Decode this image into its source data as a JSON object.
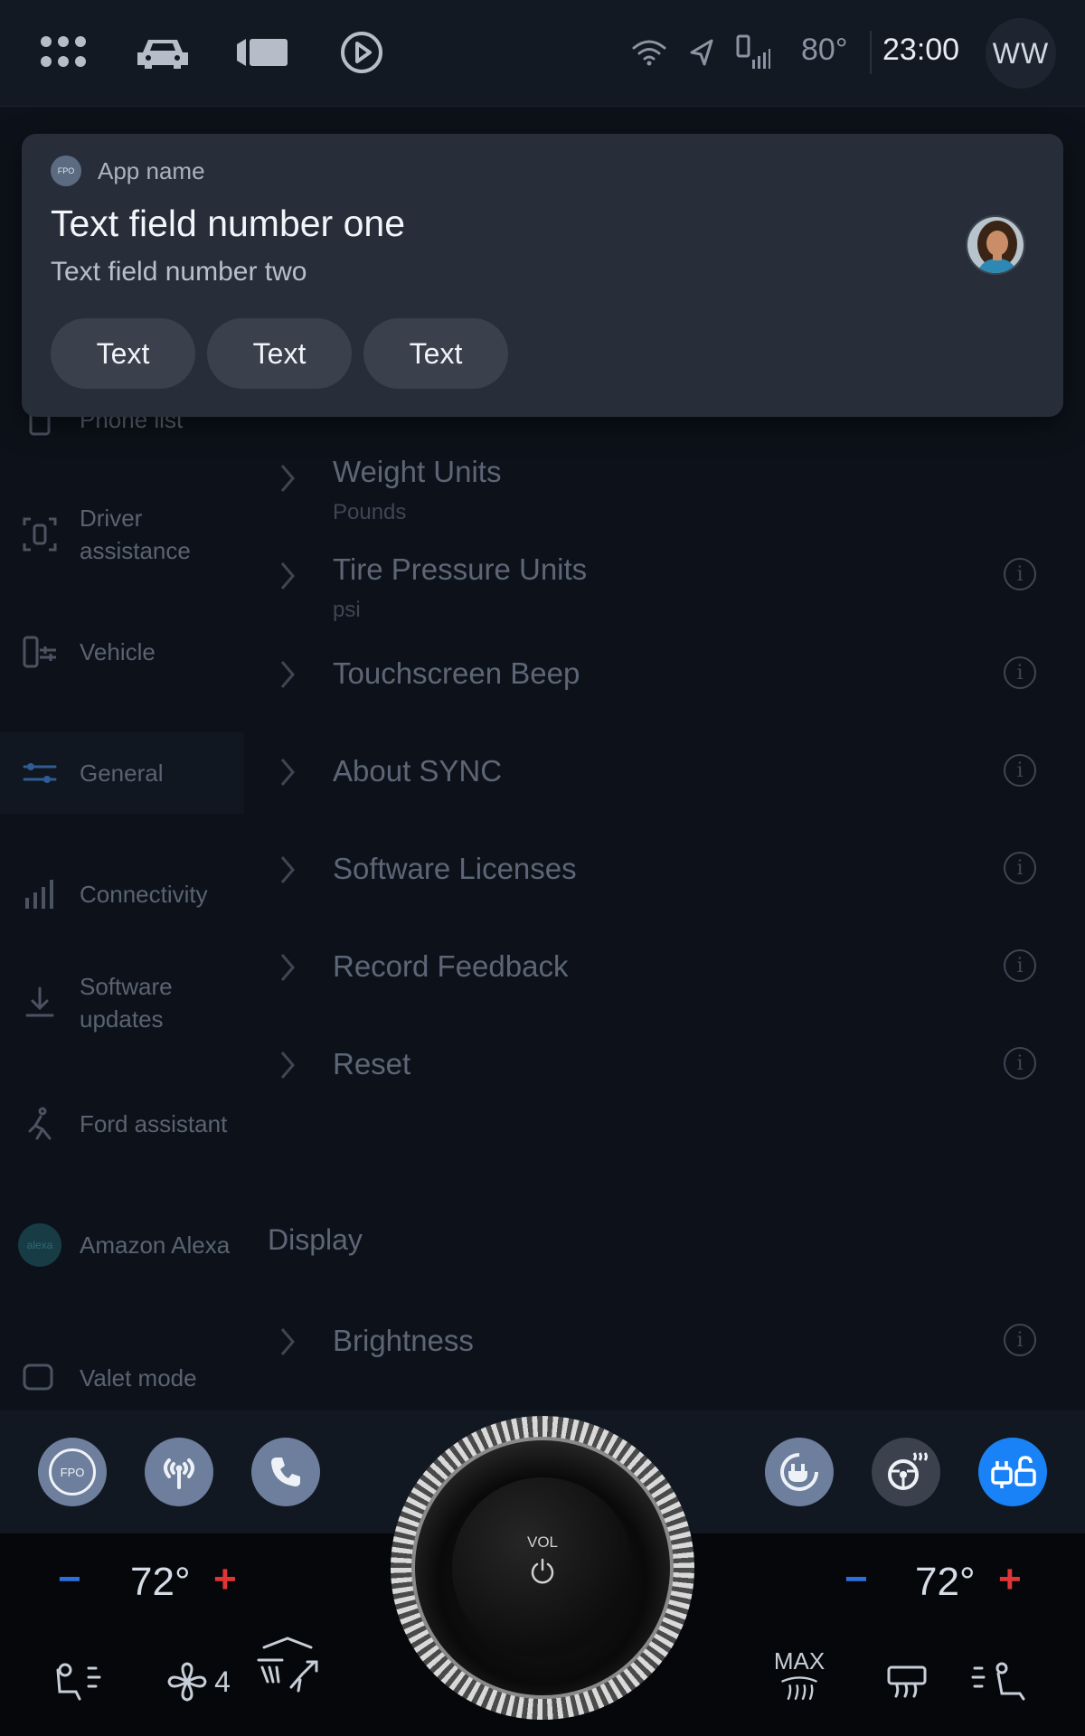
{
  "status": {
    "temperature": "80°",
    "time": "23:00",
    "user_initials": "WW"
  },
  "notification": {
    "app_name": "App name",
    "title": "Text field number one",
    "subtitle": "Text field number two",
    "buttons": [
      "Text",
      "Text",
      "Text"
    ],
    "app_badge": "FPO"
  },
  "sidebar": {
    "items": [
      {
        "label": "Phone list"
      },
      {
        "label": "Driver assistance"
      },
      {
        "label": "Vehicle"
      },
      {
        "label": "General"
      },
      {
        "label": "Connectivity"
      },
      {
        "label": "Software updates"
      },
      {
        "label": "Ford assistant"
      },
      {
        "label": "Amazon Alexa"
      },
      {
        "label": "Valet mode"
      }
    ],
    "alexa_badge": "alexa"
  },
  "settings": {
    "rows": [
      {
        "title": "Weight Units",
        "value": "Pounds"
      },
      {
        "title": "Tire Pressure Units",
        "value": "psi"
      },
      {
        "title": "Touchscreen Beep",
        "value": ""
      },
      {
        "title": "About SYNC",
        "value": ""
      },
      {
        "title": "Software Licenses",
        "value": ""
      },
      {
        "title": "Record Feedback",
        "value": ""
      },
      {
        "title": "Reset",
        "value": ""
      }
    ],
    "display_section": "Display",
    "display_rows": [
      {
        "title": "Brightness"
      }
    ]
  },
  "dock": {
    "fpo_label": "FPO",
    "vol_label": "VOL"
  },
  "climate": {
    "left_temp": "72°",
    "right_temp": "72°",
    "fan_speed": "4",
    "max_label": "MAX",
    "minus": "−",
    "plus": "+"
  },
  "colors": {
    "accent_blue": "#1a82f7",
    "minus_blue": "#2f6fdc",
    "plus_red": "#e03535",
    "dock_button": "#6e7f9d"
  }
}
